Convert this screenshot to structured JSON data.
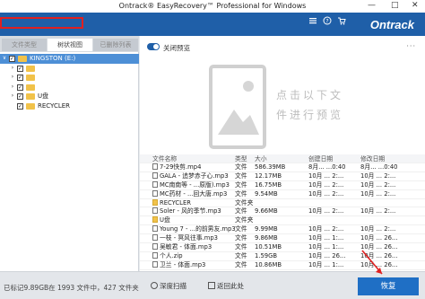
{
  "window": {
    "title": "Ontrack® EasyRecovery™ Professional for Windows",
    "controls": [
      "—",
      "□",
      "✕"
    ]
  },
  "header": {
    "logo": "Ontrack",
    "icons": [
      "menu-icon",
      "help-icon",
      "cart-icon"
    ]
  },
  "tabs": [
    "文件类型",
    "树状视图",
    "已删除列表"
  ],
  "tree": [
    {
      "label": "KINGSTON (E:)",
      "indent": 0,
      "chev": "∨",
      "selected": true
    },
    {
      "label": "",
      "indent": 1,
      "chev": "›"
    },
    {
      "label": "",
      "indent": 1,
      "chev": "›"
    },
    {
      "label": "",
      "indent": 1,
      "chev": "›"
    },
    {
      "label": "U盘",
      "indent": 1,
      "chev": "›"
    },
    {
      "label": "RECYCLER",
      "indent": 1,
      "chev": ""
    }
  ],
  "preview": {
    "toggle_label": "关闭预览",
    "menu": "···",
    "hint_line1": "点击以下文",
    "hint_line2": "件进行预览"
  },
  "table": {
    "headers": {
      "name": "文件名称",
      "type": "类型",
      "size": "大小",
      "created": "创建日期",
      "modified": "修改日期"
    },
    "rows": [
      {
        "name": "7-29快剪.mp4",
        "type": "文件",
        "size": "586.39MB",
        "created": "8月... ...0:40",
        "modified": "8月... ...0:40",
        "folder": false
      },
      {
        "name": "GALA - 追梦赤子心.mp3",
        "type": "文件",
        "size": "12.17MB",
        "created": "10月 ... 2:...",
        "modified": "10月 ... 2:...",
        "folder": false
      },
      {
        "name": "MC南南等 - ...原版).mp3",
        "type": "文件",
        "size": "16.75MB",
        "created": "10月 ... 2:...",
        "modified": "10月 ... 2:...",
        "folder": false
      },
      {
        "name": "MC药材 - ...回大唐.mp3",
        "type": "文件",
        "size": "9.54MB",
        "created": "10月 ... 2:...",
        "modified": "10月 ... 2:...",
        "folder": false
      },
      {
        "name": "RECYCLER",
        "type": "文件夹",
        "size": "",
        "created": "",
        "modified": "",
        "folder": true
      },
      {
        "name": "Soler - 风的季节.mp3",
        "type": "文件",
        "size": "9.66MB",
        "created": "10月 ... 2:...",
        "modified": "10月 ... 2:...",
        "folder": false
      },
      {
        "name": "U盘",
        "type": "文件夹",
        "size": "",
        "created": "",
        "modified": "",
        "folder": true
      },
      {
        "name": "Young 7 - ...的前男友.mp3",
        "type": "文件",
        "size": "9.99MB",
        "created": "10月 ... 2:...",
        "modified": "10月 ... 2:...",
        "folder": false
      },
      {
        "name": "一枝 - 冥风往事.mp3",
        "type": "文件",
        "size": "9.86MB",
        "created": "10月 ... 1:...",
        "modified": "10月 ... 26...",
        "folder": false
      },
      {
        "name": "吴敏君 - 体面.mp3",
        "type": "文件",
        "size": "10.51MB",
        "created": "10月 ... 1:...",
        "modified": "10月 ... 26...",
        "folder": false
      },
      {
        "name": "个人.zip",
        "type": "文件",
        "size": "1.59GB",
        "created": "10月 ... 26...",
        "modified": "10月 ... 26...",
        "folder": false
      },
      {
        "name": "卫兰 - 体面.mp3",
        "type": "文件",
        "size": "10.86MB",
        "created": "10月 ... 1:...",
        "modified": "10月 ... 26...",
        "folder": false
      }
    ]
  },
  "bottom": {
    "status": "已标记9.89GB在 1993 文件中，427 文件夹",
    "deep_scan": "深度扫描",
    "quick_scan": "返回此处",
    "recover": "恢复"
  },
  "colors": {
    "brand": "#1f5fa8",
    "highlight": "#e02020",
    "folder": "#f1c24a"
  }
}
